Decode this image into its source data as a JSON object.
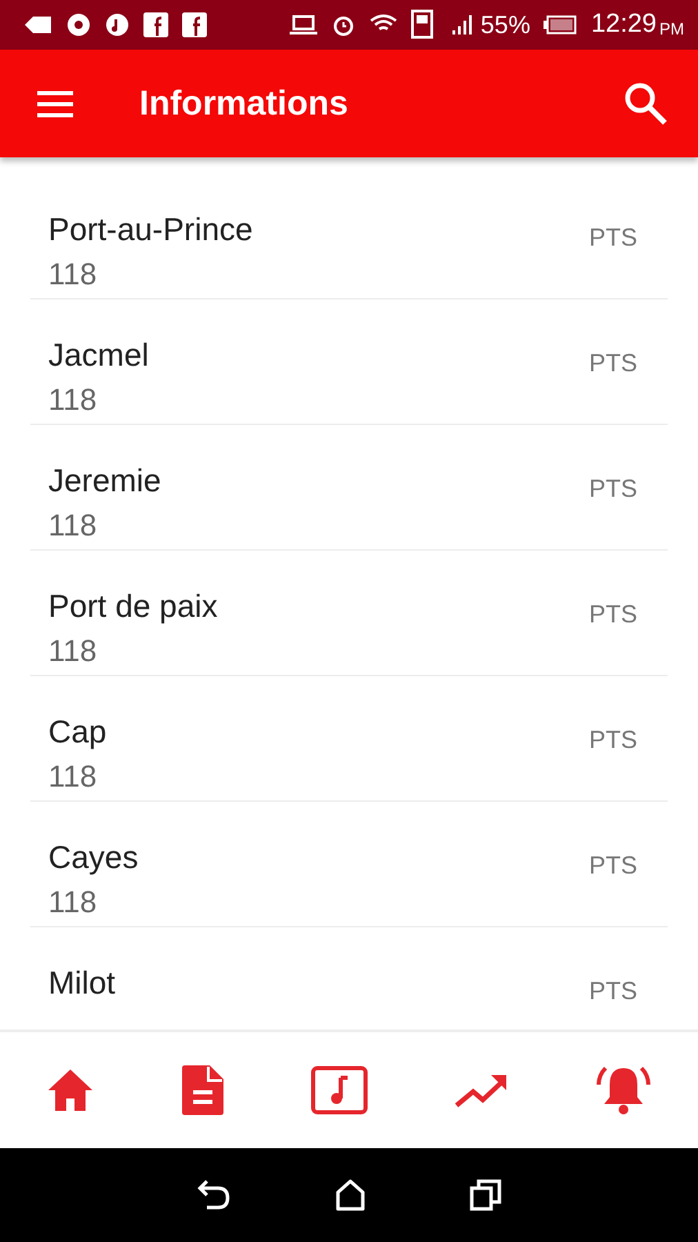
{
  "status_bar": {
    "battery": "55%",
    "time": "12:29",
    "ampm": "PM"
  },
  "app_bar": {
    "title": "Informations"
  },
  "rows": [
    {
      "name": "Port-au-Prince",
      "value": "118",
      "unit": "PTS"
    },
    {
      "name": "Jacmel",
      "value": "118",
      "unit": "PTS"
    },
    {
      "name": "Jeremie",
      "value": "118",
      "unit": "PTS"
    },
    {
      "name": "Port de paix",
      "value": "118",
      "unit": "PTS"
    },
    {
      "name": "Cap",
      "value": "118",
      "unit": "PTS"
    },
    {
      "name": "Cayes",
      "value": "118",
      "unit": "PTS"
    },
    {
      "name": "Milot",
      "unit": "PTS"
    }
  ],
  "bottom_nav": [
    {
      "kind": "home"
    },
    {
      "kind": "document"
    },
    {
      "kind": "music"
    },
    {
      "kind": "trend"
    },
    {
      "kind": "bell"
    }
  ]
}
